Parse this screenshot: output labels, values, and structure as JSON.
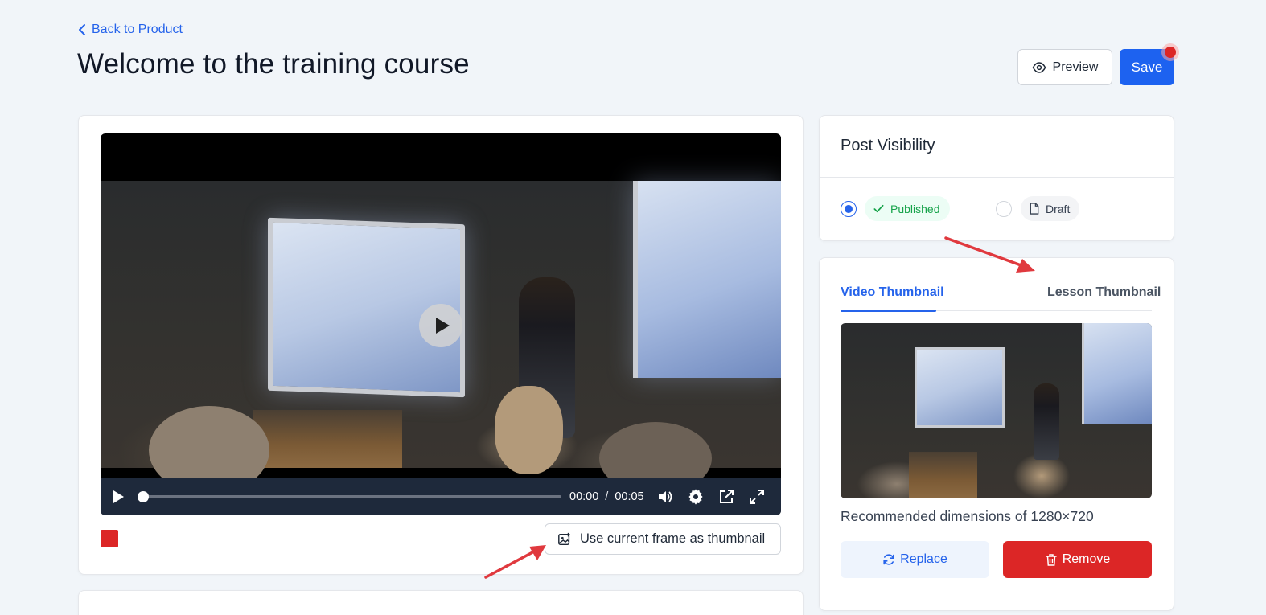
{
  "nav": {
    "back_label": "Back to Product"
  },
  "page": {
    "title": "Welcome to the training course"
  },
  "header_actions": {
    "preview_label": "Preview",
    "save_label": "Save"
  },
  "video_player": {
    "current_time": "00:00",
    "time_separator": "/",
    "duration": "00:05",
    "progress_fraction": 0,
    "icons": [
      "play-icon",
      "volume-icon",
      "settings-icon",
      "pip-icon",
      "fullscreen-icon"
    ]
  },
  "thumbnail_action": {
    "label": "Use current frame as thumbnail"
  },
  "post_visibility": {
    "title": "Post Visibility",
    "options": [
      {
        "label": "Published",
        "selected": true
      },
      {
        "label": "Draft",
        "selected": false
      }
    ]
  },
  "thumbnails": {
    "tabs": [
      {
        "label": "Video Thumbnail",
        "active": true
      },
      {
        "label": "Lesson Thumbnail",
        "active": false
      }
    ],
    "recommended_text": "Recommended dimensions of 1280×720",
    "replace_label": "Replace",
    "remove_label": "Remove"
  },
  "colors": {
    "accent": "#2563eb",
    "save": "#1d62f0",
    "danger": "#dc2626",
    "success": "#16a34a",
    "background": "#f1f5f9",
    "annotation_arrow": "#e0393e"
  }
}
